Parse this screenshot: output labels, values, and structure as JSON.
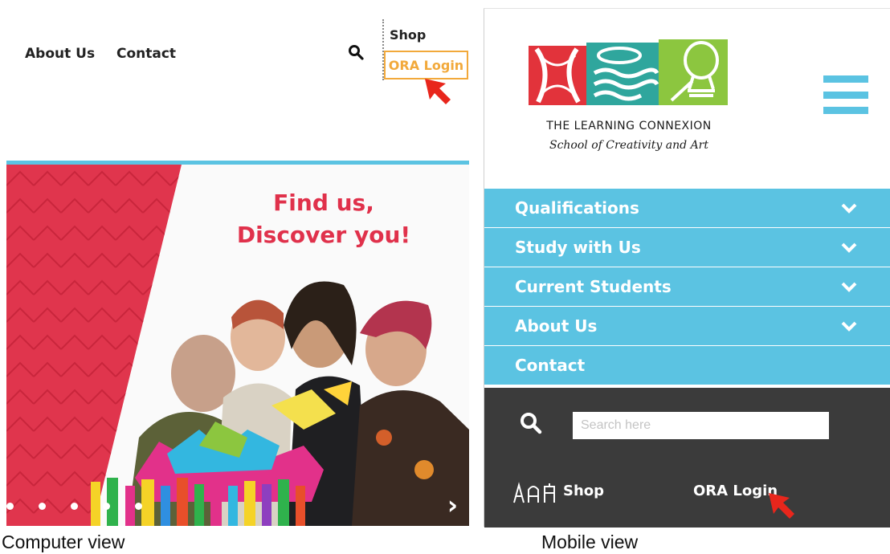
{
  "desktop": {
    "nav": {
      "about": "About Us",
      "contact": "Contact",
      "shop": "Shop",
      "ora_login": "ORA Login"
    },
    "hero": {
      "heading_line1": "Find us,",
      "heading_line2": "Discover you!",
      "slide_dot_count": 5
    },
    "icons": {
      "search": "search-icon",
      "annotation": "red-arrow-icon",
      "next": "chevron-right-icon"
    }
  },
  "mobile": {
    "brand": {
      "name": "THE LEARNING CONNEXION",
      "tagline": "School of Creativity and Art"
    },
    "menu": [
      {
        "label": "Qualifications",
        "expandable": true
      },
      {
        "label": "Study with Us",
        "expandable": true
      },
      {
        "label": "Current Students",
        "expandable": true
      },
      {
        "label": "About Us",
        "expandable": true
      },
      {
        "label": "Contact",
        "expandable": false
      }
    ],
    "search": {
      "placeholder": "Search here"
    },
    "footer": {
      "shop": "Shop",
      "ora_login": "ORA Login"
    },
    "icons": {
      "menu": "hamburger-icon",
      "search": "search-icon",
      "shop": "art-tools-icon",
      "expand": "chevron-down-icon"
    }
  },
  "captions": {
    "left": "Computer view",
    "right": "Mobile view"
  },
  "colors": {
    "accent_blue": "#5bc3e2",
    "login_orange": "#f2a93b",
    "hero_red": "#e0314b",
    "dark_panel": "#3b3b3b",
    "annotation_red": "#e8261c"
  }
}
